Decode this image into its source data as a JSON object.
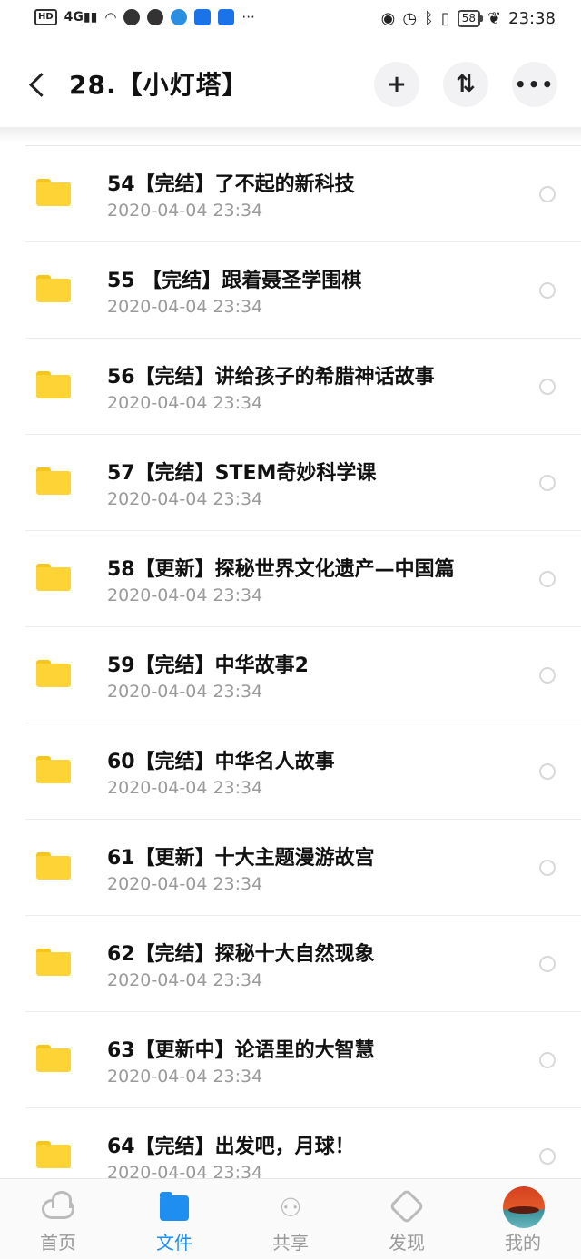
{
  "status_bar": {
    "left_badge": "HD",
    "network": "4G",
    "more": "···",
    "battery": "58",
    "time": "23:38"
  },
  "header": {
    "title": "28.【小灯塔】",
    "add_icon": "plus-icon",
    "sort_icon": "sort-icon",
    "more_icon": "more-icon"
  },
  "files": [
    {
      "name": "54【完结】了不起的新科技",
      "date": "2020-04-04  23:34"
    },
    {
      "name": "55 【完结】跟着聂圣学围棋",
      "date": "2020-04-04  23:34"
    },
    {
      "name": "56【完结】讲给孩子的希腊神话故事",
      "date": "2020-04-04  23:34"
    },
    {
      "name": "57【完结】STEM奇妙科学课",
      "date": "2020-04-04  23:34"
    },
    {
      "name": "58【更新】探秘世界文化遗产—中国篇",
      "date": "2020-04-04  23:34"
    },
    {
      "name": "59【完结】中华故事2",
      "date": "2020-04-04  23:34"
    },
    {
      "name": "60【完结】中华名人故事",
      "date": "2020-04-04  23:34"
    },
    {
      "name": "61【更新】十大主题漫游故宫",
      "date": "2020-04-04  23:34"
    },
    {
      "name": "62【完结】探秘十大自然现象",
      "date": "2020-04-04  23:34"
    },
    {
      "name": "63【更新中】论语里的大智慧",
      "date": "2020-04-04  23:34"
    },
    {
      "name": "64【完结】出发吧，月球！",
      "date": "2020-04-04  23:34"
    }
  ],
  "nav": {
    "home": "首页",
    "files": "文件",
    "share": "共享",
    "discover": "发现",
    "mine": "我的"
  },
  "colors": {
    "accent": "#1e8ff0",
    "folder": "#fdd335",
    "muted": "#9a9a9a"
  }
}
